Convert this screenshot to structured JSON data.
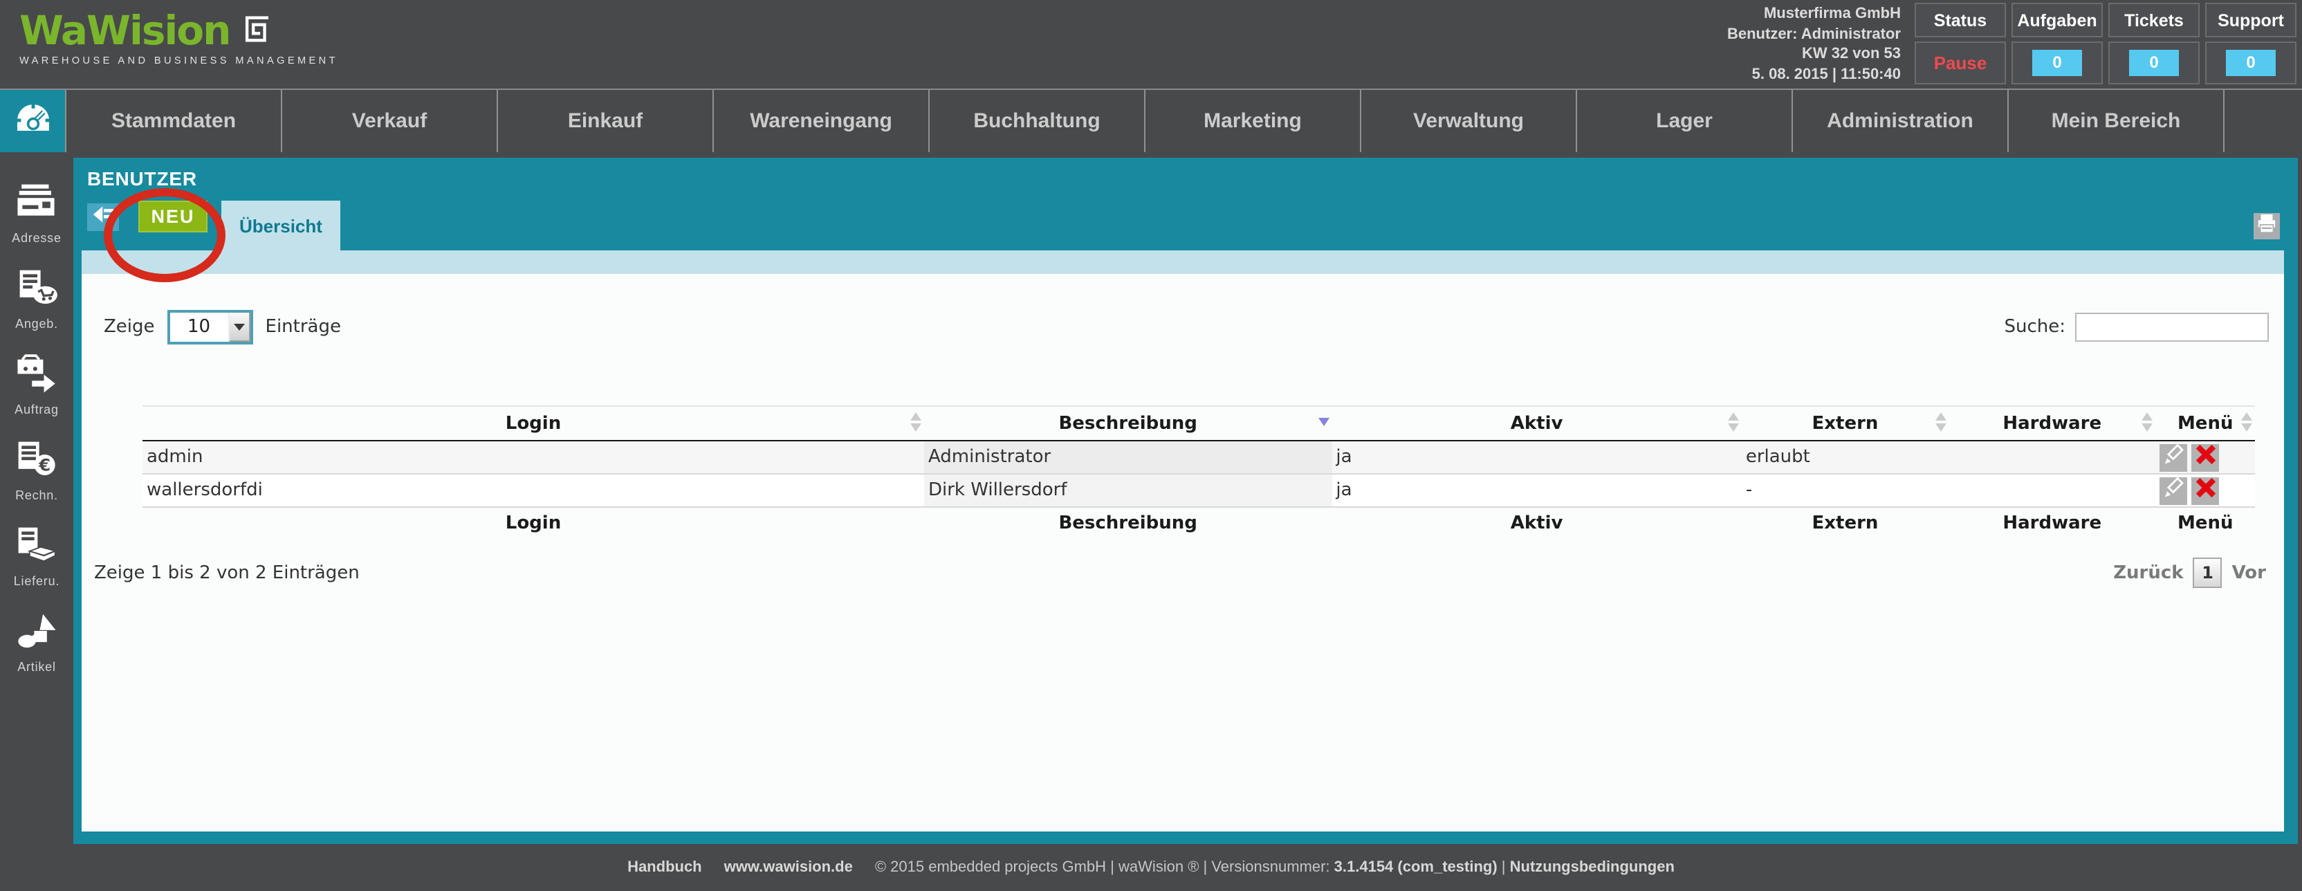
{
  "app": {
    "brand": "WaWision",
    "tagline": "WAREHOUSE AND BUSINESS MANAGEMENT"
  },
  "header": {
    "company": "Musterfirma GmbH",
    "user_line": "Benutzer: Administrator",
    "week_line": "KW 32 von 53",
    "datetime_line": "5. 08. 2015 | 11:50:40",
    "status_columns": [
      {
        "label": "Status",
        "value": "Pause"
      },
      {
        "label": "Aufgaben",
        "value": "0"
      },
      {
        "label": "Tickets",
        "value": "0"
      },
      {
        "label": "Support",
        "value": "0"
      }
    ]
  },
  "nav": {
    "items": [
      "Stammdaten",
      "Verkauf",
      "Einkauf",
      "Wareneingang",
      "Buchhaltung",
      "Marketing",
      "Verwaltung",
      "Lager",
      "Administration",
      "Mein Bereich"
    ]
  },
  "sidebar": {
    "items": [
      {
        "label": "Adresse",
        "icon": "address-card-icon"
      },
      {
        "label": "Angeb.",
        "icon": "offer-cart-icon"
      },
      {
        "label": "Auftrag",
        "icon": "order-arrow-icon"
      },
      {
        "label": "Rechn.",
        "icon": "invoice-euro-icon"
      },
      {
        "label": "Lieferu.",
        "icon": "delivery-box-icon"
      },
      {
        "label": "Artikel",
        "icon": "article-shapes-icon"
      }
    ]
  },
  "page": {
    "title": "BENUTZER",
    "new_button_label": "NEU",
    "tab_label": "Übersicht",
    "length_prefix": "Zeige",
    "length_value": "10",
    "length_suffix": "Einträge",
    "search_label": "Suche:",
    "search_value": "",
    "table": {
      "columns": [
        "Login",
        "Beschreibung",
        "Aktiv",
        "Extern",
        "Hardware",
        "Menü"
      ],
      "sorted_column": "Beschreibung",
      "rows": [
        {
          "login": "admin",
          "beschreibung": "Administrator",
          "aktiv": "ja",
          "extern": "erlaubt",
          "hardware": ""
        },
        {
          "login": "wallersdorfdi",
          "beschreibung": "Dirk Willersdorf",
          "aktiv": "ja",
          "extern": "-",
          "hardware": ""
        }
      ],
      "info": "Zeige 1 bis 2 von 2 Einträgen",
      "pagination": {
        "prev": "Zurück",
        "current": "1",
        "next": "Vor"
      }
    }
  },
  "footer": {
    "handbuch": "Handbuch",
    "website": "www.wawision.de",
    "copyright": "© 2015 embedded projects GmbH | waWision ® | Versionsnummer:",
    "version": "3.1.4154 (com_testing)",
    "separator": "|",
    "terms": "Nutzungsbedingungen"
  },
  "icons": {
    "nav_home": "gauge-icon",
    "toolbar": [
      "back-icon",
      "print-icon"
    ],
    "row_actions": [
      "edit-pencil-icon",
      "delete-x-icon"
    ]
  },
  "colors": {
    "teal_accent": "#178a9f",
    "light_blue": "#c3e1ea",
    "brand_green": "#7ab62b",
    "button_green": "#8cb714",
    "annotation_red": "#d52a1c",
    "delete_red": "#e30613",
    "pause_red": "#ef4a4e",
    "badge_cyan": "#55c9f0",
    "frame_dark": "#48494b"
  }
}
